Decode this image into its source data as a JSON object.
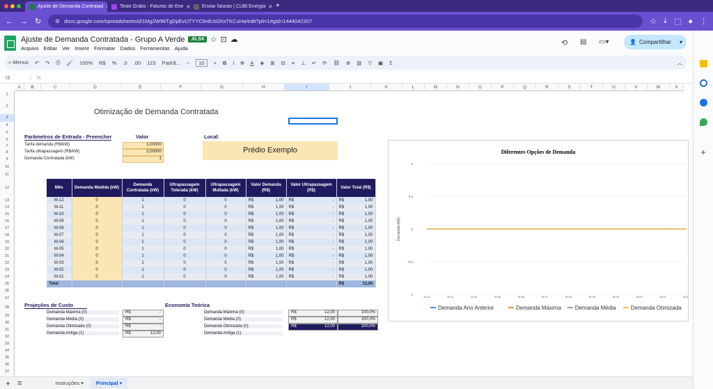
{
  "browser": {
    "tabs": [
      {
        "label": "Ajuste de Demanda Contratad",
        "color": "#188038"
      },
      {
        "label": "Teste Grátis - Faturas de Ene",
        "color": "#a142f4"
      },
      {
        "label": "Enviar faturas | CUBi Energia",
        "color": "#5f6368"
      }
    ],
    "url": "docs.google.com/spreadsheets/d/1Mg2W96TgDpEvUTYYC6rdUsGhxTKCuHa/edit?pli=1#gid=1444042207"
  },
  "doc": {
    "title": "Ajuste de Demanda Contratada - Grupo A Verde",
    "badge": ".XLSX",
    "menus": [
      "Arquivo",
      "Editar",
      "Ver",
      "Inserir",
      "Formatar",
      "Dados",
      "Ferramentas",
      "Ajuda"
    ],
    "share": "Compartilhar"
  },
  "toolbar": {
    "search": "Menus",
    "zoom": "100%",
    "currency": "R$",
    "percent": "%",
    "dec1": ".0",
    "dec2": ".00",
    "num": "123",
    "font": "Padrã...",
    "fontsize": "10"
  },
  "namebox": "I3",
  "fx": "fx",
  "columns": [
    "A",
    "B",
    "C",
    "D",
    "E",
    "F",
    "G",
    "H",
    "I",
    "J",
    "K",
    "L",
    "M",
    "N",
    "O",
    "P",
    "Q",
    "R",
    "S",
    "T",
    "U",
    "V",
    "W",
    "X"
  ],
  "rows": [
    "1",
    "2",
    "3",
    "4",
    "5",
    "6",
    "7",
    "8",
    "9",
    "10",
    "11",
    "12",
    "13",
    "14",
    "15",
    "16",
    "17",
    "18",
    "19",
    "20",
    "21",
    "22",
    "23",
    "24",
    "25",
    "26",
    "27",
    "28",
    "29",
    "30",
    "31",
    "32",
    "33",
    "34",
    "35",
    "36",
    "37",
    "38",
    "39"
  ],
  "sheet": {
    "title": "Otimização de Demanda Contratada",
    "params_header": "Parâmetros de Entrada - Preencher",
    "valor_header": "Valor",
    "local_label": "Local:",
    "local_value": "Prédio Exemplo",
    "params": [
      {
        "label": "Tarifa demanda (R$/kW)",
        "value": "1,00000"
      },
      {
        "label": "Tarifa ultrapassagem (R$/kW)",
        "value": "2,00000"
      },
      {
        "label": "Demanda Contratada (kW)",
        "value": "1"
      }
    ],
    "table_headers": [
      "Mês",
      "Demanda Medida (kW)",
      "Demanda Contratada (kW)",
      "Ultrapassagem Tolerada (kW)",
      "Ultrapassagem Multada (kW)",
      "Valor Demanda (R$)",
      "Valor Ultrapassagem (R$)",
      "Valor Total (R$)"
    ],
    "months": [
      "M-12",
      "M-11",
      "M-10",
      "M-09",
      "M-08",
      "M-07",
      "M-06",
      "M-05",
      "M-04",
      "M-03",
      "M-02",
      "M-01"
    ],
    "row_vals": {
      "medida": "0",
      "contratada": "1",
      "tolerada": "0",
      "multada": "0",
      "cur": "R$",
      "vdem": "1,00",
      "vult": "-",
      "vtot": "1,00"
    },
    "total_label": "Total",
    "total_cur": "R$",
    "total_value": "12,00",
    "proj_header": "Projeções de Custo",
    "econ_header": "Economia Teórica",
    "proj": [
      {
        "label": "Demanda Máxima (0)",
        "cur": "R$",
        "val": "-"
      },
      {
        "label": "Demanda Média (0)",
        "cur": "R$",
        "val": "-"
      },
      {
        "label": "Demanda Otimizada (0)",
        "cur": "R$",
        "val": "-"
      },
      {
        "label": "Demanda Antiga (1)",
        "cur": "R$",
        "val": "12,00"
      }
    ],
    "econ": [
      {
        "label": "Demanda Máxima (0)",
        "cur": "R$",
        "val": "12,00",
        "pct": "100,0%"
      },
      {
        "label": "Demanda Média (0)",
        "cur": "R$",
        "val": "12,00",
        "pct": "100,0%"
      },
      {
        "label": "Demanda Otimizada (0)",
        "cur": "R$",
        "val": "12,00",
        "pct": "100,0%"
      },
      {
        "label": "Demanda Antiga (1)"
      }
    ]
  },
  "chart_data": {
    "type": "line",
    "title": "Diferentes Opções de Demanda",
    "ylabel": "Demanda (kW)",
    "xlabel": "",
    "categories": [
      "M-12",
      "M-11",
      "M-10",
      "M-09",
      "M-08",
      "M-07",
      "M-06",
      "M-05",
      "M-04",
      "M-03",
      "M-02",
      "M-01"
    ],
    "ylim": [
      -1,
      1
    ],
    "yticks": [
      "1",
      "0,5",
      "0",
      "-0,5",
      "-1"
    ],
    "series": [
      {
        "name": "Demanda Ano Anterior",
        "color": "#4a86e8",
        "values": [
          0,
          0,
          0,
          0,
          0,
          0,
          0,
          0,
          0,
          0,
          0,
          0
        ]
      },
      {
        "name": "Demanda Máxima",
        "color": "#e69138",
        "values": [
          0,
          0,
          0,
          0,
          0,
          0,
          0,
          0,
          0,
          0,
          0,
          0
        ]
      },
      {
        "name": "Demanda Média",
        "color": "#999999",
        "values": [
          0,
          0,
          0,
          0,
          0,
          0,
          0,
          0,
          0,
          0,
          0,
          0
        ]
      },
      {
        "name": "Demanda Otimizada",
        "color": "#f1c232",
        "values": [
          0,
          0,
          0,
          0,
          0,
          0,
          0,
          0,
          0,
          0,
          0,
          0
        ]
      }
    ],
    "legend": "bottom"
  },
  "sheettabs": [
    {
      "label": "Instruções"
    },
    {
      "label": "Principal"
    }
  ]
}
